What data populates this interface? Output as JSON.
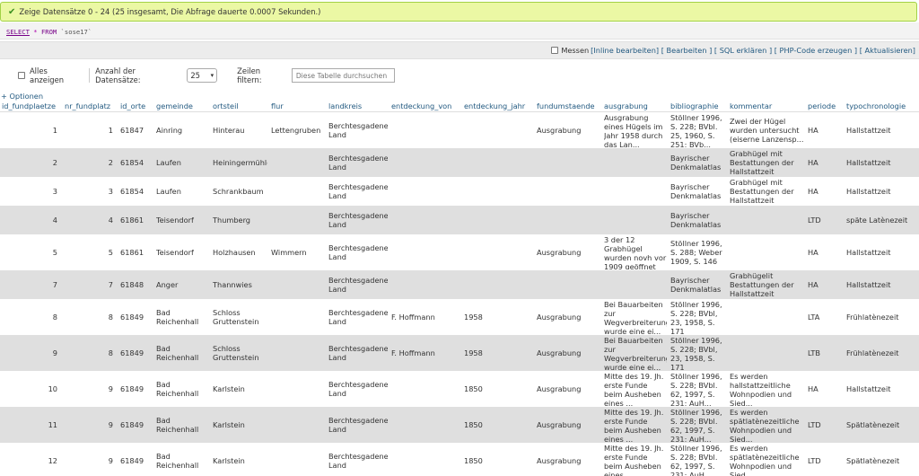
{
  "status": {
    "message": "Zeige Datensätze 0 - 24 (25 insgesamt, Die Abfrage dauerte 0.0007 Sekunden.)"
  },
  "sql": {
    "select": "SELECT",
    "star": "*",
    "from": "FROM",
    "table": "`sose17`"
  },
  "tools": {
    "messen": "Messen",
    "inline_edit": "[Inline bearbeiten]",
    "edit": "[ Bearbeiten ]",
    "sql_explain": "[ SQL erklären ]",
    "php_code": "[ PHP-Code erzeugen ]",
    "refresh": "[ Aktualisieren]"
  },
  "nav": {
    "show_all": "Alles anzeigen",
    "rows_label": "Anzahl der Datensätze:",
    "rows_value": "25",
    "filter_label": "Zeilen filtern:",
    "filter_placeholder": "Diese Tabelle durchsuchen"
  },
  "options_link": "+ Optionen",
  "table": {
    "columns": [
      "id_fundplaetze",
      "nr_fundplatz",
      "id_orte",
      "gemeinde",
      "ortsteil",
      "flur",
      "landkreis",
      "entdeckung_von",
      "entdeckung_jahr",
      "fundumstaende",
      "ausgrabung",
      "bibliographie",
      "kommentar",
      "periode",
      "typochronologie"
    ],
    "rows": [
      [
        "1",
        "1",
        "61847",
        "Ainring",
        "Hinterau",
        "Lettengruben",
        "Berchtesgadener Land",
        "",
        "",
        "Ausgrabung",
        "Ausgrabung eines Hügels im Jahr 1958 durch das Lan...",
        "Stöllner 1996, S. 228; BVbl. 25, 1960, S. 251; BVb...",
        "Zwei der Hügel wurden untersucht (eiserne Lanzensp...",
        "HA",
        "Hallstattzeit"
      ],
      [
        "2",
        "2",
        "61854",
        "Laufen",
        "Heiningermühle",
        "",
        "Berchtesgadener Land",
        "",
        "",
        "",
        "",
        "Bayrischer Denkmalatlas",
        "Grabhügel mit Bestattungen der Hallstattzeit",
        "HA",
        "Hallstattzeit"
      ],
      [
        "3",
        "3",
        "61854",
        "Laufen",
        "Schrankbaum",
        "",
        "Berchtesgadener Land",
        "",
        "",
        "",
        "",
        "Bayrischer Denkmalatlas",
        "Grabhügel mit Bestattungen der Hallstattzeit",
        "HA",
        "Hallstattzeit"
      ],
      [
        "4",
        "4",
        "61861",
        "Teisendorf",
        "Thumberg",
        "",
        "Berchtesgadener Land",
        "",
        "",
        "",
        "",
        "Bayrischer Denkmalatlas",
        "",
        "LTD",
        "späte Latènezeit"
      ],
      [
        "5",
        "5",
        "61861",
        "Teisendorf",
        "Holzhausen",
        "Wimmern",
        "Berchtesgadener Land",
        "",
        "",
        "Ausgrabung",
        "3 der 12 Grabhügel wurden novh vor 1909 geöffnet (...",
        "Stöllner 1996, S. 288; Weber 1909, S. 146",
        "",
        "HA",
        "Hallstattzeit"
      ],
      [
        "7",
        "7",
        "61848",
        "Anger",
        "Thannwies",
        "",
        "Berchtesgadener Land",
        "",
        "",
        "",
        "",
        "Bayrischer Denkmalatlas",
        "Grabhügelit Bestattungen der Hallstattzeit",
        "HA",
        "Hallstattzeit"
      ],
      [
        "8",
        "8",
        "61849",
        "Bad Reichenhall",
        "Schloss Gruttenstein",
        "",
        "Berchtesgadener Land",
        "F. Hoffmann",
        "1958",
        "Ausgrabung",
        "Bei Bauarbeiten zur Wegverbreiterung wurde eine ei...",
        "Stöllner 1996, S. 228; BVbl, 23, 1958, S. 171",
        "",
        "LTA",
        "Frühlatènezeit"
      ],
      [
        "9",
        "8",
        "61849",
        "Bad Reichenhall",
        "Schloss Gruttenstein",
        "",
        "Berchtesgadener Land",
        "F. Hoffmann",
        "1958",
        "Ausgrabung",
        "Bei Bauarbeiten zur Wegverbreiterung wurde eine ei...",
        "Stöllner 1996, S. 228; BVbl, 23, 1958, S. 171",
        "",
        "LTB",
        "Frühlatènezeit"
      ],
      [
        "10",
        "9",
        "61849",
        "Bad Reichenhall",
        "Karlstein",
        "",
        "Berchtesgadener Land",
        "",
        "1850",
        "Ausgrabung",
        "Mitte des 19. Jh. erste Funde beim Ausheben eines ...",
        "Stöllner 1996, S. 228; BVbl. 62, 1997, S. 231; AuH...",
        "Es werden hallstattzeitliche Wohnpodien und Sied...",
        "HA",
        "Hallstattzeit"
      ],
      [
        "11",
        "9",
        "61849",
        "Bad Reichenhall",
        "Karlstein",
        "",
        "Berchtesgadener Land",
        "",
        "1850",
        "Ausgrabung",
        "Mitte des 19. Jh. erste Funde beim Ausheben eines ...",
        "Stöllner 1996, S. 228; BVbl. 62, 1997, S. 231; AuH...",
        "Es werden spätlatènezeitliche Wohnpodien und Sied...",
        "LTD",
        "Spätlatènezeit"
      ],
      [
        "12",
        "9",
        "61849",
        "Bad Reichenhall",
        "Karlstein",
        "",
        "Berchtesgadener Land",
        "",
        "1850",
        "Ausgrabung",
        "Mitte des 19. Jh. erste Funde beim Ausheben eines ...",
        "Stöllner 1996, S. 228; BVbl. 62, 1997, S. 231; AuH...",
        "Es werden spätlatènezeitliche Wohnpodien und Sied...",
        "LTD",
        "Spätlatènezeit"
      ]
    ]
  }
}
